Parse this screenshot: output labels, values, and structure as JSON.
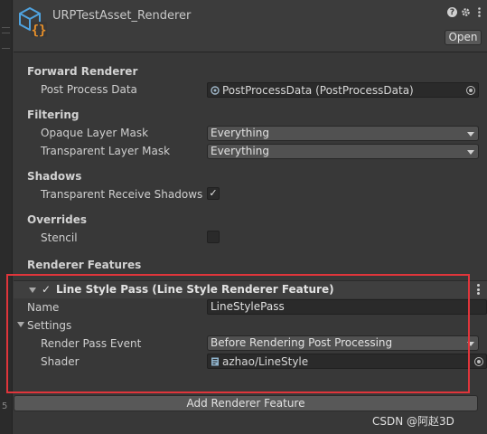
{
  "header": {
    "title": "URPTestAsset_Renderer",
    "open_label": "Open",
    "icons": [
      "help-icon",
      "settings-icon",
      "more-icon"
    ]
  },
  "forward_renderer": {
    "title": "Forward Renderer",
    "post_process_label": "Post Process Data",
    "post_process_value": "PostProcessData (PostProcessData)"
  },
  "filtering": {
    "title": "Filtering",
    "opaque_label": "Opaque Layer Mask",
    "opaque_value": "Everything",
    "transparent_label": "Transparent Layer Mask",
    "transparent_value": "Everything"
  },
  "shadows": {
    "title": "Shadows",
    "receive_label": "Transparent Receive Shadows",
    "receive_checked": true
  },
  "overrides": {
    "title": "Overrides",
    "stencil_label": "Stencil",
    "stencil_checked": false
  },
  "renderer_features": {
    "title": "Renderer Features",
    "feature_title": "Line Style Pass (Line Style Renderer Feature)",
    "feature_enabled": true,
    "name_label": "Name",
    "name_value": "LineStylePass",
    "settings_label": "Settings",
    "render_pass_event_label": "Render Pass Event",
    "render_pass_event_value": "Before Rendering Post Processing",
    "shader_label": "Shader",
    "shader_value": "azhao/LineStyle",
    "add_button_label": "Add Renderer Feature"
  },
  "watermark": "CSDN @阿赵3D",
  "left_strip_text": "5",
  "colors": {
    "highlight": "#e0353b",
    "icon_blue": "#4fa3e0",
    "icon_orange": "#e8902a"
  }
}
